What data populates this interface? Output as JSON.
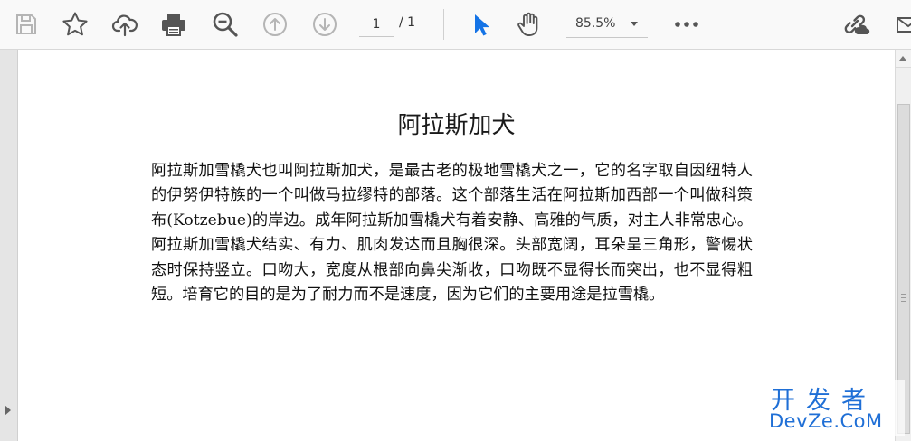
{
  "toolbar": {
    "icons": [
      "save-icon",
      "star-icon",
      "cloud-upload-icon",
      "print-icon",
      "zoom-out-icon",
      "prev-page-icon",
      "next-page-icon",
      "select-cursor-icon",
      "hand-tool-icon",
      "more-icon",
      "share-link-icon",
      "email-icon"
    ],
    "page_current": "1",
    "page_total": "/ 1",
    "zoom": "85.5%",
    "accent_color": "#1473e6"
  },
  "document": {
    "title": "阿拉斯加犬",
    "body": "阿拉斯加雪橇犬也叫阿拉斯加犬，是最古老的极地雪橇犬之一，它的名字取自因纽特人的伊努伊特族的一个叫做马拉缪特的部落。这个部落生活在阿拉斯加西部一个叫做科策布(Kotzebue)的岸边。成年阿拉斯加雪橇犬有着安静、高雅的气质，对主人非常忠心。阿拉斯加雪橇犬结实、有力、肌肉发达而且胸很深。头部宽阔，耳朵呈三角形，警惕状态时保持竖立。口吻大，宽度从根部向鼻尖渐收，口吻既不显得长而突出，也不显得粗短。培育它的目的是为了耐力而不是速度，因为它们的主要用途是拉雪橇。"
  },
  "watermark": {
    "line1": "开发者",
    "line2": "DevZe.CoM",
    "color": "#1f6fd6"
  }
}
